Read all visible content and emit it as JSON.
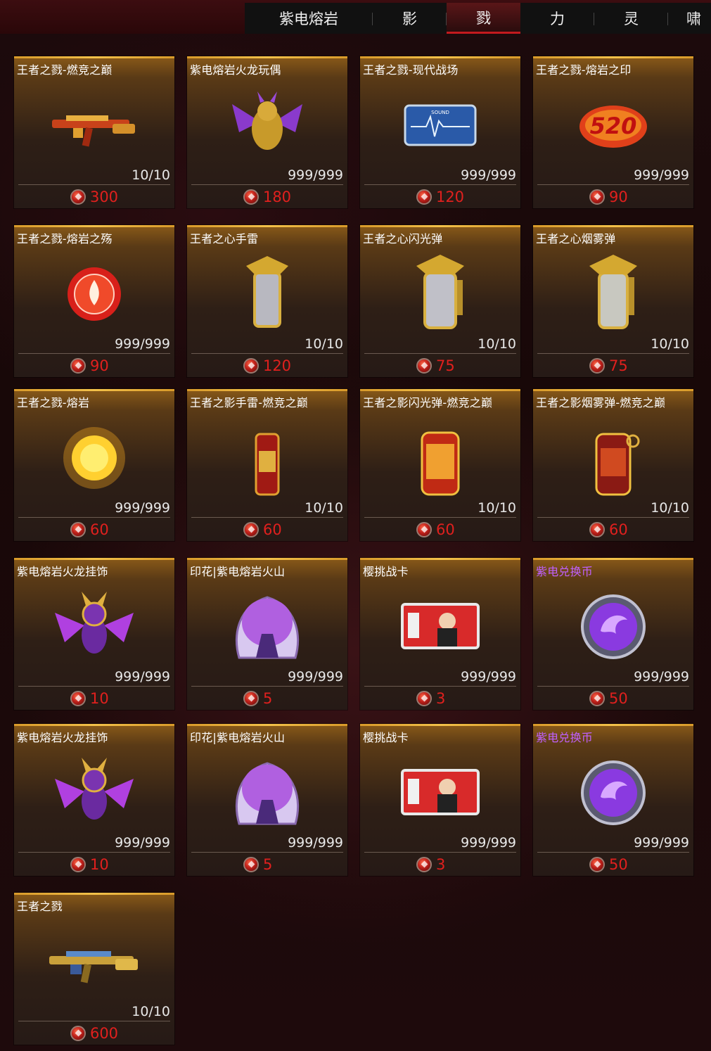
{
  "tabs": [
    {
      "label": "紫电熔岩",
      "active": false
    },
    {
      "label": "影",
      "active": false
    },
    {
      "label": "戮",
      "active": true
    },
    {
      "label": "力",
      "active": false
    },
    {
      "label": "灵",
      "active": false
    },
    {
      "label": "啸",
      "active": false
    }
  ],
  "colors": {
    "price": "#e0201e",
    "card_top": "#f3c14a",
    "active_tab": "#c21a1e",
    "name_purple": "#c060ff"
  },
  "items": [
    {
      "name": "王者之戮-燃竞之巅",
      "stock": "10/10",
      "price": "300",
      "icon": "rifle-red-gold-icon",
      "purple": false
    },
    {
      "name": "紫电熔岩火龙玩偶",
      "stock": "999/999",
      "price": "180",
      "icon": "dragon-doll-icon",
      "purple": false
    },
    {
      "name": "王者之戮-现代战场",
      "stock": "999/999",
      "price": "120",
      "icon": "sound-card-icon",
      "purple": false
    },
    {
      "name": "王者之戮-熔岩之印",
      "stock": "999/999",
      "price": "90",
      "icon": "520-spray-icon",
      "purple": false
    },
    {
      "name": "王者之戮-熔岩之殇",
      "stock": "999/999",
      "price": "90",
      "icon": "flame-emblem-icon",
      "purple": false
    },
    {
      "name": "王者之心手雷",
      "stock": "10/10",
      "price": "120",
      "icon": "grenade-gold-icon",
      "purple": false
    },
    {
      "name": "王者之心闪光弹",
      "stock": "10/10",
      "price": "75",
      "icon": "flashbang-gold-icon",
      "purple": false
    },
    {
      "name": "王者之心烟雾弹",
      "stock": "10/10",
      "price": "75",
      "icon": "smoke-grenade-gold-icon",
      "purple": false
    },
    {
      "name": "王者之戮-熔岩",
      "stock": "999/999",
      "price": "60",
      "icon": "sun-burst-icon",
      "purple": false
    },
    {
      "name": "王者之影手雷-燃竞之巅",
      "stock": "10/10",
      "price": "60",
      "icon": "grenade-red-icon",
      "purple": false
    },
    {
      "name": "王者之影闪光弹-燃竞之巅",
      "stock": "10/10",
      "price": "60",
      "icon": "flashbang-red-icon",
      "purple": false
    },
    {
      "name": "王者之影烟雾弹-燃竞之巅",
      "stock": "10/10",
      "price": "60",
      "icon": "smoke-grenade-red-icon",
      "purple": false
    },
    {
      "name": "紫电熔岩火龙挂饰",
      "stock": "999/999",
      "price": "10",
      "icon": "dragon-charm-icon",
      "purple": false
    },
    {
      "name": "印花|紫电熔岩火山",
      "stock": "999/999",
      "price": "5",
      "icon": "volcano-sticker-icon",
      "purple": false
    },
    {
      "name": "樱挑战卡",
      "stock": "999/999",
      "price": "3",
      "icon": "challenge-card-icon",
      "purple": false
    },
    {
      "name": "紫电兑换币",
      "stock": "999/999",
      "price": "50",
      "icon": "purple-coin-icon",
      "purple": true
    },
    {
      "name": "紫电熔岩火龙挂饰",
      "stock": "999/999",
      "price": "10",
      "icon": "dragon-charm-icon",
      "purple": false
    },
    {
      "name": "印花|紫电熔岩火山",
      "stock": "999/999",
      "price": "5",
      "icon": "volcano-sticker-icon",
      "purple": false
    },
    {
      "name": "樱挑战卡",
      "stock": "999/999",
      "price": "3",
      "icon": "challenge-card-icon",
      "purple": false
    },
    {
      "name": "紫电兑换币",
      "stock": "999/999",
      "price": "50",
      "icon": "purple-coin-icon",
      "purple": true
    },
    {
      "name": "王者之戮",
      "stock": "10/10",
      "price": "600",
      "icon": "rifle-gold-blue-icon",
      "purple": false
    }
  ]
}
